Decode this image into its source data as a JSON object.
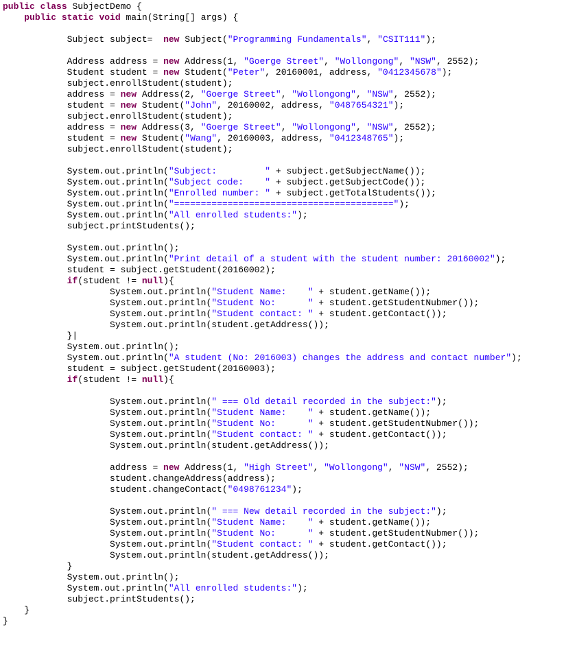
{
  "code": {
    "class_decl": "public class SubjectDemo {",
    "main_decl": "public static void main(String[] args) {",
    "s_subject_new": "Subject subject=  new Subject(\"Programming Fundamentals\", \"CSIT111\");",
    "s_addr1": "Address address = new Address(1, \"Goerge Street\", \"Wollongong\", \"NSW\", 2552);",
    "s_stud1": "Student student = new Student(\"Peter\", 20160001, address, \"0412345678\");",
    "s_enroll1": "subject.enrollStudent(student);",
    "s_addr2": "address = new Address(2, \"Goerge Street\", \"Wollongong\", \"NSW\", 2552);",
    "s_stud2": "student = new Student(\"John\", 20160002, address, \"0487654321\");",
    "s_enroll2": "subject.enrollStudent(student);",
    "s_addr3": "address = new Address(3, \"Goerge Street\", \"Wollongong\", \"NSW\", 2552);",
    "s_stud3": "student = new Student(\"Wang\", 20160003, address, \"0412348765\");",
    "s_enroll3": "subject.enrollStudent(student);",
    "p_subject": "System.out.println(\"Subject:         \" + subject.getSubjectName());",
    "p_subjectcode": "System.out.println(\"Subject code:    \" + subject.getSubjectCode());",
    "p_enrolled": "System.out.println(\"Enrolled number: \" + subject.getTotalStudents());",
    "p_sep": "System.out.println(\"=========================================\");",
    "p_all": "System.out.println(\"All enrolled students:\");",
    "p_printstudents": "subject.printStudents();",
    "p_blank": "System.out.println();",
    "p_detail_hdr": "System.out.println(\"Print detail of a student with the student number: 20160002\");",
    "s_getstud2": "student = subject.getStudent(20160002);",
    "if_notnull": "if(student != null){",
    "p_stud_name": "System.out.println(\"Student Name:    \" + student.getName());",
    "p_stud_no": "System.out.println(\"Student No:      \" + student.getStudentNubmer());",
    "p_stud_contact": "System.out.println(\"Student contact: \" + student.getContact());",
    "p_stud_addr": "System.out.println(student.getAddress());",
    "endif_caret": "}|",
    "p_change_hdr": "System.out.println(\"A student (No: 2016003) changes the address and contact number\");",
    "s_getstud3": "student = subject.getStudent(20160003);",
    "p_old": "System.out.println(\" === Old detail recorded in the subject:\");",
    "s_newaddr": "address = new Address(1, \"High Street\", \"Wollongong\", \"NSW\", 2552);",
    "s_changeaddr": "student.changeAddress(address);",
    "s_changecontact": "student.changeContact(\"0498761234\");",
    "p_new": "System.out.println(\" === New detail recorded in the subject:\");",
    "endif": "}",
    "close_main": "}",
    "close_class": "}"
  }
}
